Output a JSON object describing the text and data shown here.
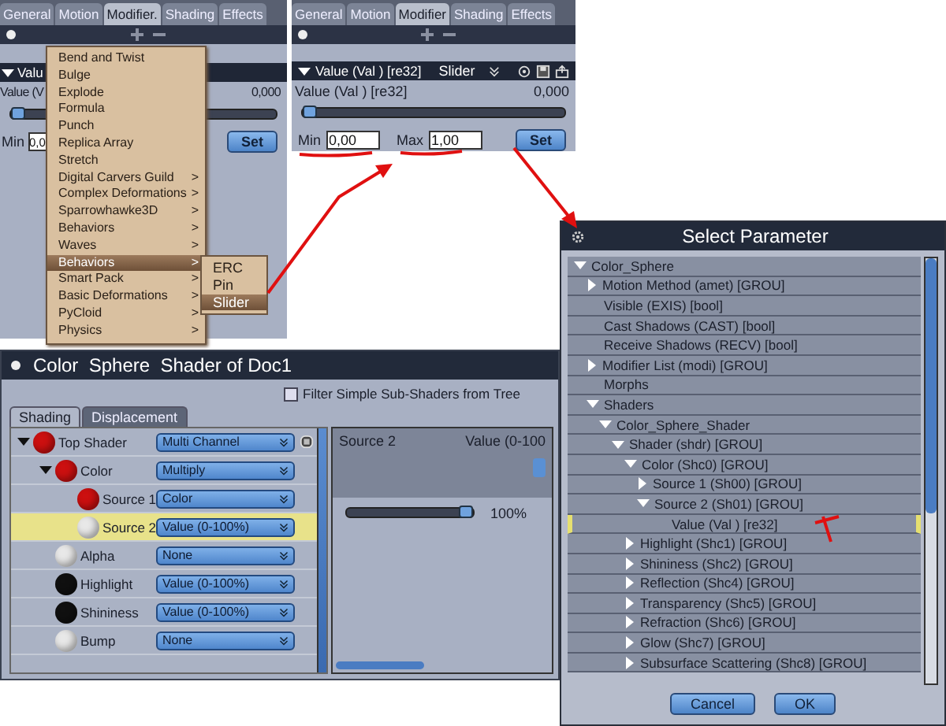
{
  "modifier_panel": {
    "tabs": [
      {
        "label": "General",
        "selected": false
      },
      {
        "label": "Motion",
        "selected": false
      },
      {
        "label": "Modifier.",
        "selected": true
      },
      {
        "label": "Shading",
        "selected": false
      },
      {
        "label": "Effects",
        "selected": false
      }
    ],
    "header_title": "Valu",
    "value_label": "Value (V",
    "value_reading": "0,000",
    "slider": {
      "level": 0
    },
    "min_label": "Min",
    "min_value": "0,0",
    "set_button": "Set",
    "menu": [
      {
        "label": "Bend and Twist",
        "selected": false
      },
      {
        "label": "Bulge",
        "selected": false
      },
      {
        "label": "Explode",
        "selected": false
      },
      {
        "label": "Formula",
        "selected": false
      },
      {
        "label": "Punch",
        "selected": false
      },
      {
        "label": "Replica Array",
        "selected": false
      },
      {
        "label": "Stretch",
        "selected": false
      },
      {
        "label": "Digital Carvers Guild",
        "arrow": ">",
        "selected": false
      },
      {
        "label": "Complex Deformations",
        "arrow": ">",
        "selected": false
      },
      {
        "label": "Sparrowhawke3D",
        "arrow": ">",
        "selected": false
      },
      {
        "label": "Behaviors",
        "arrow": ">",
        "selected": false
      },
      {
        "label": "Waves",
        "arrow": ">",
        "selected": false
      },
      {
        "label": "Behaviors",
        "arrow": ">",
        "selected": true
      },
      {
        "label": "Smart Pack",
        "arrow": ">",
        "selected": false
      },
      {
        "label": "Basic Deformations",
        "arrow": ">",
        "selected": false
      },
      {
        "label": "PyCloid",
        "arrow": ">",
        "selected": false
      },
      {
        "label": "Physics",
        "arrow": ">",
        "selected": false
      }
    ],
    "submenu": [
      {
        "label": "ERC",
        "selected": false
      },
      {
        "label": "Pin",
        "selected": false
      },
      {
        "label": "Slider",
        "selected": true
      }
    ]
  },
  "slider_panel": {
    "tabs": [
      {
        "label": "General",
        "selected": false
      },
      {
        "label": "Motion",
        "selected": false
      },
      {
        "label": "Modifier",
        "selected": true
      },
      {
        "label": "Shading",
        "selected": false
      },
      {
        "label": "Effects",
        "selected": false
      }
    ],
    "header_title": "Value (Val ) [re32]",
    "header_type": "Slider",
    "value_label": "Value (Val ) [re32]",
    "value_reading": "0,000",
    "slider": {
      "level": 0
    },
    "min_label": "Min",
    "min_value": "0,00",
    "max_label": "Max",
    "max_value": "1,00",
    "set_button": "Set"
  },
  "shader_window": {
    "title": "Color  Sphere  Shader of Doc1",
    "filter": {
      "label": "Filter Simple Sub-Shaders from Tree",
      "checked": false
    },
    "tabs": [
      {
        "label": "Shading",
        "selected": true
      },
      {
        "label": "Displacement",
        "selected": false
      }
    ],
    "tree": [
      {
        "name": "Top Shader",
        "color": "#cc1010",
        "type": "Multi Channel",
        "has_options": true,
        "expanded": true,
        "selected": false,
        "children": [
          {
            "name": "Color",
            "color": "#cc1010",
            "type": "Multiply",
            "expanded": true,
            "selected": false,
            "children": [
              {
                "name": "Source 1",
                "color": "#cc1010",
                "type": "Color",
                "selected": false
              },
              {
                "name": "Source 2",
                "color": "#e8e8e8",
                "type": "Value (0-100%)",
                "selected": true
              }
            ]
          },
          {
            "name": "Alpha",
            "color": "#e8e8e8",
            "type": "None",
            "selected": false
          },
          {
            "name": "Highlight",
            "color": "#101010",
            "type": "Value (0-100%)",
            "selected": false
          },
          {
            "name": "Shininess",
            "color": "#101010",
            "type": "Value (0-100%)",
            "selected": false
          },
          {
            "name": "Bump",
            "color": "#e8e8e8",
            "type": "None",
            "selected": false
          }
        ]
      }
    ],
    "detail": {
      "name": "Source 2",
      "type": "Value (0-100",
      "slider": {
        "level": 1
      },
      "reading": "100%"
    }
  },
  "select_parameter": {
    "title": "Select Parameter",
    "tree": [
      {
        "name": "Color_Sphere",
        "expanded": true,
        "selected": false,
        "children": [
          {
            "name": "Motion Method (amet) [GROU]",
            "expanded": false,
            "selected": false
          },
          {
            "name": "Visible (EXIS) [bool]",
            "selected": false
          },
          {
            "name": "Cast Shadows (CAST) [bool]",
            "selected": false
          },
          {
            "name": "Receive Shadows (RECV) [bool]",
            "selected": false
          },
          {
            "name": "Modifier List (modi) [GROU]",
            "expanded": false,
            "selected": false
          },
          {
            "name": "Morphs",
            "selected": false
          },
          {
            "name": "Shaders",
            "expanded": true,
            "selected": false,
            "children": [
              {
                "name": "Color_Sphere_Shader",
                "expanded": true,
                "selected": false,
                "children": [
                  {
                    "name": "Shader (shdr) [GROU]",
                    "expanded": true,
                    "selected": false,
                    "children": [
                      {
                        "name": "Color (Shc0) [GROU]",
                        "expanded": true,
                        "selected": false,
                        "children": [
                          {
                            "name": "Source 1 (Sh00) [GROU]",
                            "expanded": false,
                            "selected": false
                          },
                          {
                            "name": "Source 2 (Sh01) [GROU]",
                            "expanded": true,
                            "selected": false,
                            "children": [
                              {
                                "name": "Value (Val ) [re32]",
                                "selected": true
                              }
                            ]
                          }
                        ]
                      },
                      {
                        "name": "Highlight (Shc1) [GROU]",
                        "expanded": false,
                        "selected": false
                      },
                      {
                        "name": "Shininess (Shc2) [GROU]",
                        "expanded": false,
                        "selected": false
                      },
                      {
                        "name": "Reflection (Shc4) [GROU]",
                        "expanded": false,
                        "selected": false
                      },
                      {
                        "name": "Transparency (Shc5) [GROU]",
                        "expanded": false,
                        "selected": false
                      },
                      {
                        "name": "Refraction (Shc6) [GROU]",
                        "expanded": false,
                        "selected": false
                      },
                      {
                        "name": "Glow (Shc7) [GROU]",
                        "expanded": false,
                        "selected": false
                      },
                      {
                        "name": "Subsurface Scattering (Shc8) [GROU]",
                        "expanded": false,
                        "selected": false
                      }
                    ]
                  }
                ]
              }
            ]
          }
        ]
      }
    ],
    "buttons": [
      "Cancel",
      "OK"
    ]
  }
}
